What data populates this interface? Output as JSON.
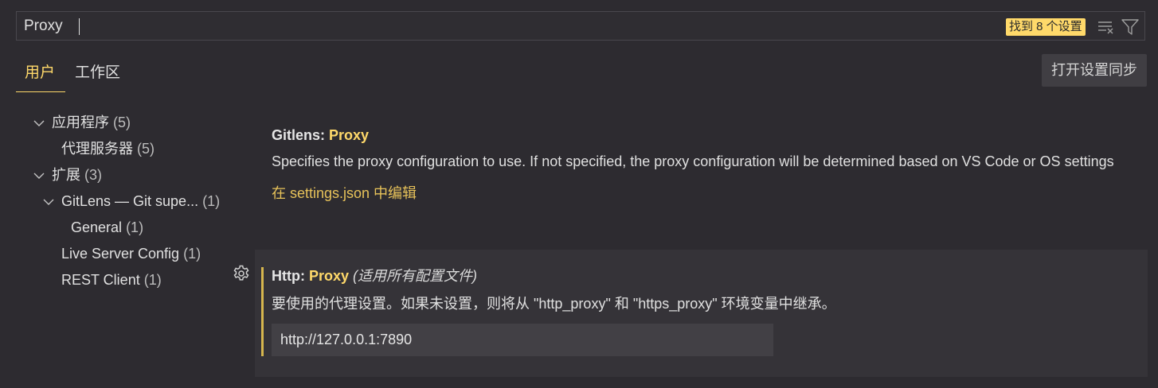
{
  "search": {
    "value": "Proxy",
    "result_badge": "找到 8 个设置",
    "clear_icon": "clear-filter-icon",
    "filter_icon": "funnel-icon"
  },
  "tabs": {
    "user": "用户",
    "workspace": "工作区",
    "active": "user"
  },
  "sync_button": "打开设置同步",
  "tree": [
    {
      "label": "应用程序",
      "count": "(5)",
      "expanded": true
    },
    {
      "label": "代理服务器",
      "count": "(5)"
    },
    {
      "label": "扩展",
      "count": "(3)",
      "expanded": true
    },
    {
      "label": "GitLens — Git supe...",
      "count": "(1)",
      "expanded": true
    },
    {
      "label": "General",
      "count": "(1)"
    },
    {
      "label": "Live Server Config",
      "count": "(1)"
    },
    {
      "label": "REST Client",
      "count": "(1)"
    }
  ],
  "settings": [
    {
      "category": "Gitlens: ",
      "name": "Proxy",
      "description": "Specifies the proxy configuration to use. If not specified, the proxy configuration will be determined based on VS Code or OS settings",
      "link": "在 settings.json 中编辑"
    },
    {
      "category": "Http: ",
      "name": "Proxy",
      "scope": "(适用所有配置文件)",
      "description": "要使用的代理设置。如果未设置，则将从 \"http_proxy\" 和 \"https_proxy\" 环境变量中继承。",
      "value": "http://127.0.0.1:7890"
    }
  ],
  "colors": {
    "background": "#2d2b30",
    "accent": "#ffd96a",
    "link": "#e8c35a"
  }
}
